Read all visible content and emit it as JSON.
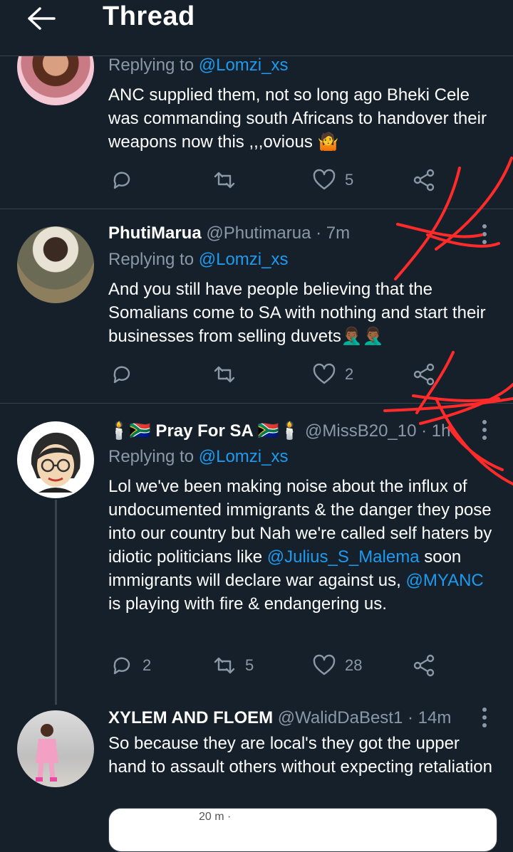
{
  "header": {
    "title": "Thread"
  },
  "tweets": [
    {
      "replying_prefix": "Replying to ",
      "replying_to": "@Lomzi_xs",
      "text": "ANC supplied them, not so long ago  Bheki Cele was commanding south Africans to handover their weapons now this ,,,ovious 🤷",
      "likes": "5"
    },
    {
      "name": "PhutiMarua",
      "handle": "@Phutimarua",
      "dot": " · ",
      "time": "7m",
      "replying_prefix": "Replying to ",
      "replying_to": "@Lomzi_xs",
      "text": "And you still have people believing that the Somalians come to SA with nothing and start their businesses from selling duvets🤦🏾‍♂️🤦🏾‍♂️",
      "likes": "2"
    },
    {
      "name": "🕯️🇿🇦 Pray For SA 🇿🇦🕯️",
      "handle": "@MissB20_10",
      "dot": " · ",
      "time": "1h",
      "replying_prefix": "Replying to ",
      "replying_to": "@Lomzi_xs",
      "text_1": "Lol we've been making noise about the influx of undocumented immigrants & the danger they pose into our country but Nah we're called self haters by idiotic politicians like ",
      "mention_1": "@Julius_S_Malema",
      "text_2": " soon immigrants will declare war against us, ",
      "mention_2": "@MYANC",
      "text_3": " is playing with fire & endangering us.",
      "replies": "2",
      "retweets": "5",
      "likes": "28"
    },
    {
      "name": "XYLEM AND FLOEM",
      "handle": "@WalidDaBest1",
      "dot": " · ",
      "time": "14m",
      "text": "So because they are local's they got the upper hand to assault others without expecting retaliation",
      "quote_time": "20 m · "
    }
  ],
  "colors": {
    "background": "#15202b",
    "link": "#1d9bf0",
    "muted": "#8b98a5",
    "divider": "#38444d",
    "annotation": "#ff2b2b"
  },
  "icons": [
    "back-arrow-icon",
    "reply-icon",
    "retweet-icon",
    "like-icon",
    "share-icon",
    "more-icon"
  ]
}
